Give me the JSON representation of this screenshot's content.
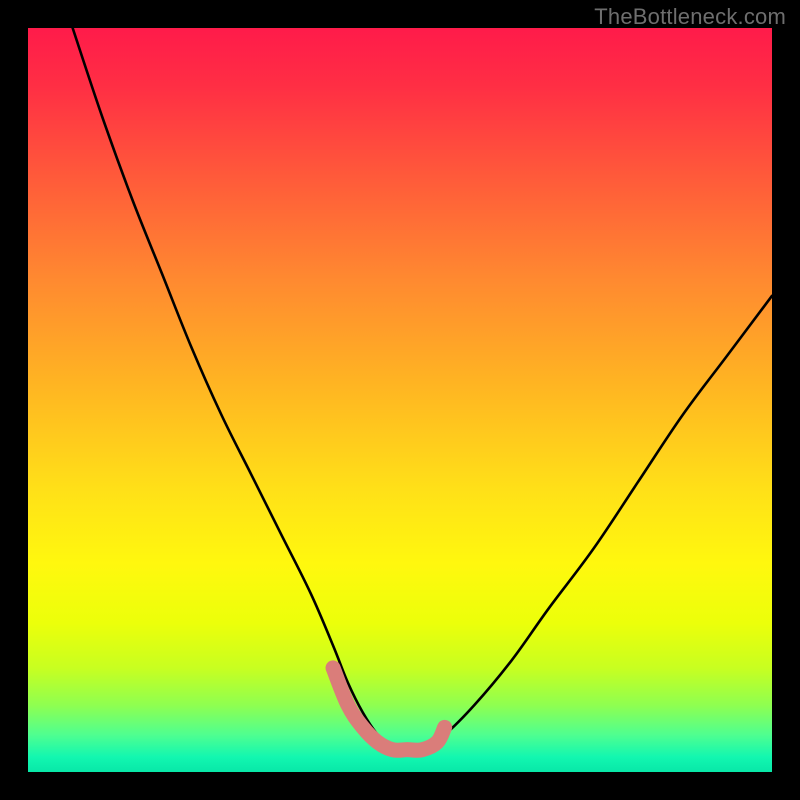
{
  "watermark": {
    "text": "TheBottleneck.com"
  },
  "colors": {
    "page_bg": "#000000",
    "curve_stroke": "#000000",
    "highlight_stroke": "#da7d7a",
    "gradient_top": "#ff1b4a",
    "gradient_mid": "#ffe018",
    "gradient_bottom": "#08e8a8"
  },
  "chart_data": {
    "type": "line",
    "title": "",
    "subtitle": "",
    "xlabel": "",
    "ylabel": "",
    "xlim": [
      0,
      100
    ],
    "ylim": [
      0,
      100
    ],
    "grid": false,
    "legend": false,
    "annotations": [],
    "series": [
      {
        "name": "bottleneck-curve",
        "x": [
          6,
          10,
          14,
          18,
          22,
          26,
          30,
          34,
          38,
          41,
          43,
          45,
          47,
          49,
          51,
          53,
          56,
          60,
          65,
          70,
          76,
          82,
          88,
          94,
          100
        ],
        "y": [
          100,
          88,
          77,
          67,
          57,
          48,
          40,
          32,
          24,
          17,
          12,
          8,
          5,
          3,
          3,
          3,
          5,
          9,
          15,
          22,
          30,
          39,
          48,
          56,
          64
        ]
      },
      {
        "name": "bottleneck-floor-highlight",
        "x": [
          41,
          43,
          45,
          47,
          49,
          51,
          53,
          55,
          56
        ],
        "y": [
          14,
          9,
          6,
          4,
          3,
          3,
          3,
          4,
          6
        ]
      }
    ]
  }
}
